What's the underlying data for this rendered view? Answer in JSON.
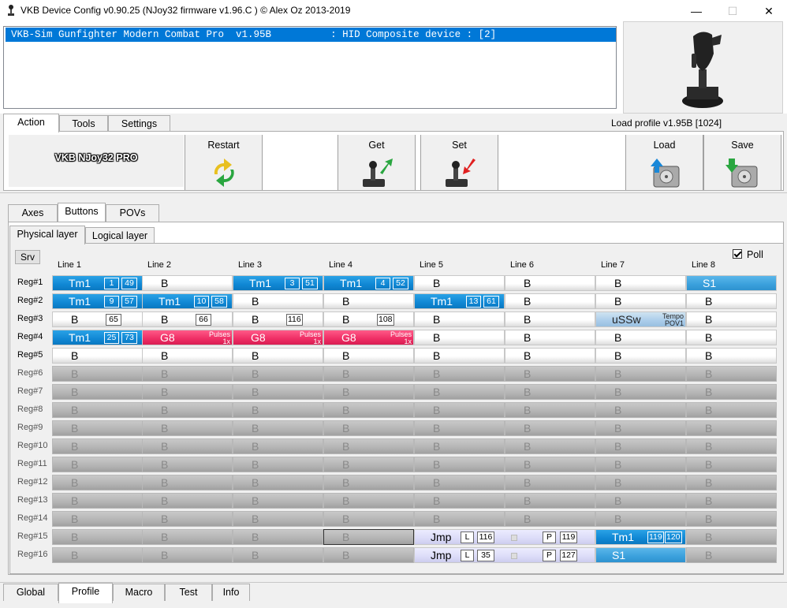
{
  "window": {
    "title": "VKB Device Config v0.90.25 (NJoy32 firmware v1.96.C  ) © Alex Oz 2013-2019",
    "minimize": "—",
    "maximize": "☐",
    "close": "✕"
  },
  "device_list": {
    "selected": "VKB-Sim Gunfighter Modern Combat Pro  v1.95B          : HID Composite device : [2]"
  },
  "main_tabs": [
    "Action",
    "Tools",
    "Settings"
  ],
  "load_profile": "Load profile  v1.95B [1024]",
  "logo_text": "VKB NJoy32 PRO",
  "actions": {
    "restart": "Restart",
    "get": "Get",
    "set": "Set",
    "load": "Load",
    "save": "Save"
  },
  "sub_tabs": [
    "Axes",
    "Buttons",
    "POVs"
  ],
  "layer_tabs": [
    "Physical layer",
    "Logical layer"
  ],
  "srv": "Srv",
  "poll": "Poll",
  "columns": [
    "Line 1",
    "Line 2",
    "Line 3",
    "Line 4",
    "Line 5",
    "Line 6",
    "Line 7",
    "Line 8"
  ],
  "rows": [
    "Reg#1",
    "Reg#2",
    "Reg#3",
    "Reg#4",
    "Reg#5",
    "Reg#6",
    "Reg#7",
    "Reg#8",
    "Reg#9",
    "Reg#10",
    "Reg#11",
    "Reg#12",
    "Reg#13",
    "Reg#14",
    "Reg#15",
    "Reg#16"
  ],
  "grid": [
    [
      {
        "s": "T",
        "t": "Tm1",
        "a": "1",
        "b": "49"
      },
      {
        "s": "B",
        "t": "B"
      },
      {
        "s": "T",
        "t": "Tm1",
        "a": "3",
        "b": "51"
      },
      {
        "s": "T",
        "t": "Tm1",
        "a": "4",
        "b": "52"
      },
      {
        "s": "B",
        "t": "B"
      },
      {
        "s": "B",
        "t": "B"
      },
      {
        "s": "B",
        "t": "B"
      },
      {
        "s": "S1",
        "t": "S1"
      }
    ],
    [
      {
        "s": "T",
        "t": "Tm1",
        "a": "9",
        "b": "57"
      },
      {
        "s": "T",
        "t": "Tm1",
        "a": "10",
        "b": "58"
      },
      {
        "s": "B",
        "t": "B"
      },
      {
        "s": "B",
        "t": "B"
      },
      {
        "s": "T",
        "t": "Tm1",
        "a": "13",
        "b": "61"
      },
      {
        "s": "B",
        "t": "B"
      },
      {
        "s": "B",
        "t": "B"
      },
      {
        "s": "B",
        "t": "B"
      }
    ],
    [
      {
        "s": "B",
        "t": "B",
        "b": "65"
      },
      {
        "s": "B",
        "t": "B",
        "b": "66"
      },
      {
        "s": "B",
        "t": "B",
        "b": "116"
      },
      {
        "s": "B",
        "t": "B",
        "b": "108"
      },
      {
        "s": "B",
        "t": "B"
      },
      {
        "s": "B",
        "t": "B"
      },
      {
        "s": "LB",
        "t": "uSSw",
        "n1": "Tempo",
        "n2": "POV1"
      },
      {
        "s": "B",
        "t": "B"
      }
    ],
    [
      {
        "s": "T",
        "t": "Tm1",
        "a": "25",
        "b": "73"
      },
      {
        "s": "P",
        "t": "G8",
        "n1": "Pulses",
        "n2": "1x"
      },
      {
        "s": "P",
        "t": "G8",
        "n1": "Pulses",
        "n2": "1x"
      },
      {
        "s": "P",
        "t": "G8",
        "n1": "Pulses",
        "n2": "1x"
      },
      {
        "s": "B",
        "t": "B"
      },
      {
        "s": "B",
        "t": "B"
      },
      {
        "s": "B",
        "t": "B"
      },
      {
        "s": "B",
        "t": "B"
      }
    ],
    [
      {
        "s": "B",
        "t": "B"
      },
      {
        "s": "B",
        "t": "B"
      },
      {
        "s": "B",
        "t": "B"
      },
      {
        "s": "B",
        "t": "B"
      },
      {
        "s": "B",
        "t": "B"
      },
      {
        "s": "B",
        "t": "B"
      },
      {
        "s": "B",
        "t": "B"
      },
      {
        "s": "B",
        "t": "B"
      }
    ],
    [
      {
        "s": "G",
        "t": "B"
      },
      {
        "s": "G",
        "t": "B"
      },
      {
        "s": "G",
        "t": "B"
      },
      {
        "s": "G",
        "t": "B"
      },
      {
        "s": "G",
        "t": "B"
      },
      {
        "s": "G",
        "t": "B"
      },
      {
        "s": "G",
        "t": "B"
      },
      {
        "s": "G",
        "t": "B"
      }
    ],
    [
      {
        "s": "G",
        "t": "B"
      },
      {
        "s": "G",
        "t": "B"
      },
      {
        "s": "G",
        "t": "B"
      },
      {
        "s": "G",
        "t": "B"
      },
      {
        "s": "G",
        "t": "B"
      },
      {
        "s": "G",
        "t": "B"
      },
      {
        "s": "G",
        "t": "B"
      },
      {
        "s": "G",
        "t": "B"
      }
    ],
    [
      {
        "s": "G",
        "t": "B"
      },
      {
        "s": "G",
        "t": "B"
      },
      {
        "s": "G",
        "t": "B"
      },
      {
        "s": "G",
        "t": "B"
      },
      {
        "s": "G",
        "t": "B"
      },
      {
        "s": "G",
        "t": "B"
      },
      {
        "s": "G",
        "t": "B"
      },
      {
        "s": "G",
        "t": "B"
      }
    ],
    [
      {
        "s": "G",
        "t": "B"
      },
      {
        "s": "G",
        "t": "B"
      },
      {
        "s": "G",
        "t": "B"
      },
      {
        "s": "G",
        "t": "B"
      },
      {
        "s": "G",
        "t": "B"
      },
      {
        "s": "G",
        "t": "B"
      },
      {
        "s": "G",
        "t": "B"
      },
      {
        "s": "G",
        "t": "B"
      }
    ],
    [
      {
        "s": "G",
        "t": "B"
      },
      {
        "s": "G",
        "t": "B"
      },
      {
        "s": "G",
        "t": "B"
      },
      {
        "s": "G",
        "t": "B"
      },
      {
        "s": "G",
        "t": "B"
      },
      {
        "s": "G",
        "t": "B"
      },
      {
        "s": "G",
        "t": "B"
      },
      {
        "s": "G",
        "t": "B"
      }
    ],
    [
      {
        "s": "G",
        "t": "B"
      },
      {
        "s": "G",
        "t": "B"
      },
      {
        "s": "G",
        "t": "B"
      },
      {
        "s": "G",
        "t": "B"
      },
      {
        "s": "G",
        "t": "B"
      },
      {
        "s": "G",
        "t": "B"
      },
      {
        "s": "G",
        "t": "B"
      },
      {
        "s": "G",
        "t": "B"
      }
    ],
    [
      {
        "s": "G",
        "t": "B"
      },
      {
        "s": "G",
        "t": "B"
      },
      {
        "s": "G",
        "t": "B"
      },
      {
        "s": "G",
        "t": "B"
      },
      {
        "s": "G",
        "t": "B"
      },
      {
        "s": "G",
        "t": "B"
      },
      {
        "s": "G",
        "t": "B"
      },
      {
        "s": "G",
        "t": "B"
      }
    ],
    [
      {
        "s": "G",
        "t": "B"
      },
      {
        "s": "G",
        "t": "B"
      },
      {
        "s": "G",
        "t": "B"
      },
      {
        "s": "G",
        "t": "B"
      },
      {
        "s": "G",
        "t": "B"
      },
      {
        "s": "G",
        "t": "B"
      },
      {
        "s": "G",
        "t": "B"
      },
      {
        "s": "G",
        "t": "B"
      }
    ],
    [
      {
        "s": "G",
        "t": "B"
      },
      {
        "s": "G",
        "t": "B"
      },
      {
        "s": "G",
        "t": "B"
      },
      {
        "s": "G",
        "t": "B"
      },
      {
        "s": "G",
        "t": "B"
      },
      {
        "s": "G",
        "t": "B"
      },
      {
        "s": "G",
        "t": "B"
      },
      {
        "s": "G",
        "t": "B"
      }
    ],
    [
      {
        "s": "G",
        "t": "B"
      },
      {
        "s": "G",
        "t": "B"
      },
      {
        "s": "G",
        "t": "B"
      },
      {
        "s": "G",
        "t": "B",
        "sel": true
      },
      {
        "s": "J",
        "t": "Jmp",
        "l": "L",
        "lv": "116",
        "p": "P",
        "pv": "119"
      },
      {
        "s": "J",
        "t": ""
      },
      {
        "s": "T",
        "t": "Tm1",
        "a": "119",
        "b": "120"
      },
      {
        "s": "G",
        "t": "B"
      }
    ],
    [
      {
        "s": "G",
        "t": "B"
      },
      {
        "s": "G",
        "t": "B"
      },
      {
        "s": "G",
        "t": "B"
      },
      {
        "s": "G",
        "t": "B"
      },
      {
        "s": "J",
        "t": "Jmp",
        "l": "L",
        "lv": "35",
        "p": "P",
        "pv": "127"
      },
      {
        "s": "J",
        "t": ""
      },
      {
        "s": "S1",
        "t": "S1"
      },
      {
        "s": "G",
        "t": "B"
      }
    ]
  ],
  "bottom_tabs": [
    "Global",
    "Profile",
    "Macro",
    "Test",
    "Info"
  ]
}
